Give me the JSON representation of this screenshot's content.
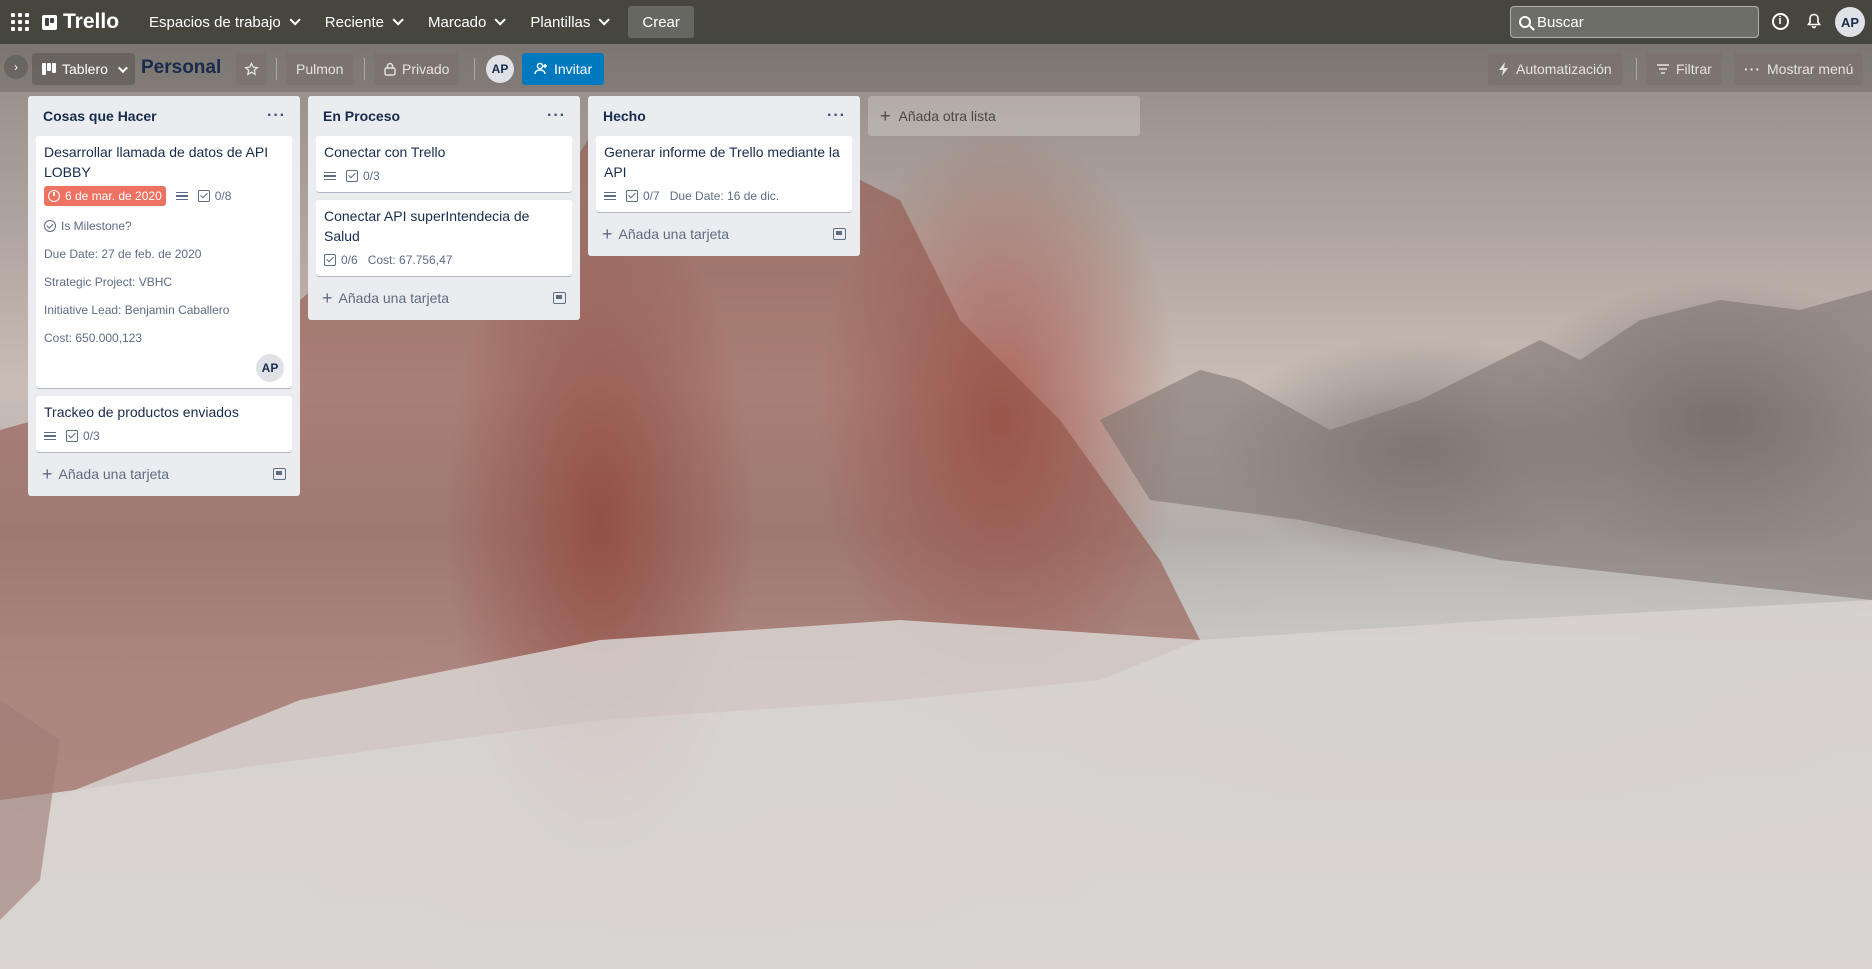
{
  "topbar": {
    "logo": "Trello",
    "nav": [
      "Espacios de trabajo",
      "Reciente",
      "Marcado",
      "Plantillas"
    ],
    "create": "Crear",
    "search_placeholder": "Buscar",
    "avatar": "AP"
  },
  "board": {
    "view": "Tablero",
    "title": "Personal",
    "workspace": "Pulmon",
    "visibility": "Privado",
    "member_avatar": "AP",
    "invite": "Invitar",
    "automation": "Automatización",
    "filter": "Filtrar",
    "menu": "Mostrar menú"
  },
  "lists": [
    {
      "title": "Cosas que Hacer",
      "cards": [
        {
          "title": "Desarrollar llamada de datos de API LOBBY",
          "due": "6 de mar. de 2020",
          "checklist": "0/8",
          "fields": [
            "Is Milestone?",
            "Due Date: 27 de feb. de 2020",
            "Strategic Project: VBHC",
            "Initiative Lead: Benjamin Caballero",
            "Cost: 650.000,123"
          ],
          "member": "AP"
        },
        {
          "title": "Trackeo de productos enviados",
          "checklist": "0/3"
        }
      ],
      "add_card": "Añada una tarjeta"
    },
    {
      "title": "En Proceso",
      "cards": [
        {
          "title": "Conectar con Trello",
          "checklist": "0/3"
        },
        {
          "title": "Conectar API superIntendecia de Salud",
          "checklist": "0/6",
          "extra": "Cost: 67.756,47"
        }
      ],
      "add_card": "Añada una tarjeta"
    },
    {
      "title": "Hecho",
      "cards": [
        {
          "title": "Generar informe de Trello mediante la API",
          "checklist": "0/7",
          "extra": "Due Date: 16 de dic."
        }
      ],
      "add_card": "Añada una tarjeta"
    }
  ],
  "add_list": "Añada otra lista",
  "colors": {
    "invite": "#0079bf",
    "due_overdue": "#eb5a46",
    "list_bg": "#ebecf0"
  }
}
